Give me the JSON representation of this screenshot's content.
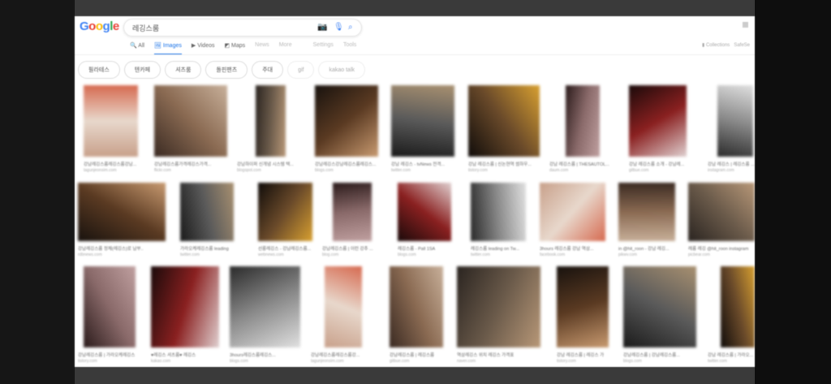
{
  "search": {
    "query": "레깅스룸"
  },
  "logo": "Google",
  "tabs": [
    {
      "label": "All"
    },
    {
      "label": "Images",
      "active": true
    },
    {
      "label": "Videos"
    },
    {
      "label": "Maps"
    },
    {
      "label": "News"
    },
    {
      "label": "More"
    },
    {
      "label": "Settings"
    },
    {
      "label": "Tools"
    }
  ],
  "right": {
    "collections": "Collections",
    "safesearch": "SafeSe"
  },
  "chips": [
    "필라테스",
    "텐카페",
    "셔츠룸",
    "돌핀팬츠",
    "주대",
    "gif",
    "kakao talk"
  ],
  "results": [
    {
      "caption": "강남레깅스룸레깅스룸강남...",
      "source": "tagunjeonsim.com"
    },
    {
      "caption": "강남레깅스룸가격레깅스가격...",
      "source": "flickr.com"
    },
    {
      "caption": "강남하이퍼 신개념 시스템 텍...",
      "source": "blogspot.com"
    },
    {
      "caption": "강남레깅스강남레깅스룸레깅스...",
      "source": "blogs.com"
    },
    {
      "caption": "강남 레깅스 - tvNews 전격...",
      "source": "twitter.com"
    },
    {
      "caption": "강남 레깅스룸 | 신논현역 썸하우...",
      "source": "tistory.com"
    },
    {
      "caption": "강남 레깅스룸 | THESAUTOL...",
      "source": "daum.com"
    },
    {
      "caption": "강남 레깅스룸 소개 - 강남레...",
      "source": "gitbue.com"
    },
    {
      "caption": "강남 레깅스 | 레깅스룸 ...",
      "source": "instagram.com"
    },
    {
      "caption": "강남레깅스룸 정체(레깅스)로 남부..",
      "source": "rdbnews.com"
    },
    {
      "caption": "가라오케레깅스룸 leading",
      "source": "twitter.com"
    },
    {
      "caption": "선릉레깅스 - 강남레깅스룸...",
      "source": "webnews.com"
    },
    {
      "caption": "강남레깅스룸 | 이런 강추 ...",
      "source": "blog.com"
    },
    {
      "caption": "레깅스룸 - Pall 1SA",
      "source": "blogs.com"
    },
    {
      "caption": "레깅스룸 leading on Tw...",
      "source": "twitter.com"
    },
    {
      "caption": "3hours 레깅스룸 강남 역삼...",
      "source": "facebook.com"
    },
    {
      "caption": "in @hit_roon - 강남 레깅...",
      "source": "pikwv.com"
    },
    {
      "caption": "레룸 레깅 @hit_roon instagram",
      "source": "picbear.com"
    },
    {
      "caption": "강남레깅스룸 | 가라오케레깅스",
      "source": "tistory.com"
    },
    {
      "caption": "♥레깅스 셔츠룸♥ 레깅스",
      "source": "kakao.com"
    },
    {
      "caption": "3hours레깅스룸레깅스...",
      "source": "blogs.com"
    },
    {
      "caption": "강남레깅스룸레깅스룸강...",
      "source": "tagunjeonsim.com"
    },
    {
      "caption": "강남레깅스룸 | 레깅스룸",
      "source": "gitbue.com"
    },
    {
      "caption": "역삼레깅스 위치 레깅스 가격표",
      "source": "naver.com"
    },
    {
      "caption": "강남 레깅스룸 | 레깅스 가",
      "source": "tistory.com"
    },
    {
      "caption": "강남레깅스룸 | 강남레깅스룸...",
      "source": "blogs.com"
    },
    {
      "caption": "강남 레깅스룸 | 가라오...",
      "source": "twitter.com"
    }
  ],
  "colors": {
    "accent": "#1a73e8"
  }
}
